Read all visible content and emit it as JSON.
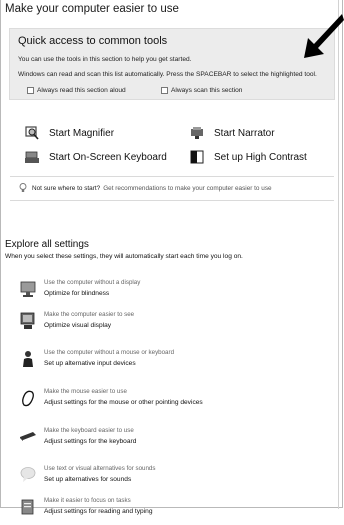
{
  "page": {
    "title": "Make your computer easier to use"
  },
  "quick_access": {
    "title": "Quick access to common tools",
    "line1": "You can use the tools in this section to help you get started.",
    "line2": "Windows can read and scan this list automatically.  Press the SPACEBAR to select the highlighted tool.",
    "check_read": "Always read this section aloud",
    "check_scan": "Always scan this section"
  },
  "tools": {
    "magnifier": "Start Magnifier",
    "narrator": "Start Narrator",
    "keyboard": "Start On-Screen Keyboard",
    "contrast": "Set up High Contrast"
  },
  "hint": {
    "strong": "Not sure where to start?",
    "link": "Get recommendations to make your computer easier to use"
  },
  "explore": {
    "title": "Explore all settings",
    "desc": "When you select these settings, they will automatically start each time you log on.",
    "items": [
      {
        "sub": "Use the computer without a display",
        "main": "Optimize for blindness"
      },
      {
        "sub": "Make the computer easier to see",
        "main": "Optimize visual display"
      },
      {
        "sub": "Use the computer without a mouse or keyboard",
        "main": "Set up alternative input devices"
      },
      {
        "sub": "Make the mouse easier to use",
        "main": "Adjust settings for the mouse or other pointing devices"
      },
      {
        "sub": "Make the keyboard easier to use",
        "main": "Adjust settings for the keyboard"
      },
      {
        "sub": "Use text or visual alternatives for sounds",
        "main": "Set up alternatives for sounds"
      },
      {
        "sub": "Make it easier to focus on tasks",
        "main": "Adjust settings for reading and typing"
      }
    ]
  },
  "icons": {
    "arrow": "black-arrow-icon",
    "magnifier": "magnifier-icon",
    "narrator": "narrator-icon",
    "keyboard": "keyboard-icon",
    "contrast": "high-contrast-icon",
    "bulb": "lightbulb-icon"
  }
}
